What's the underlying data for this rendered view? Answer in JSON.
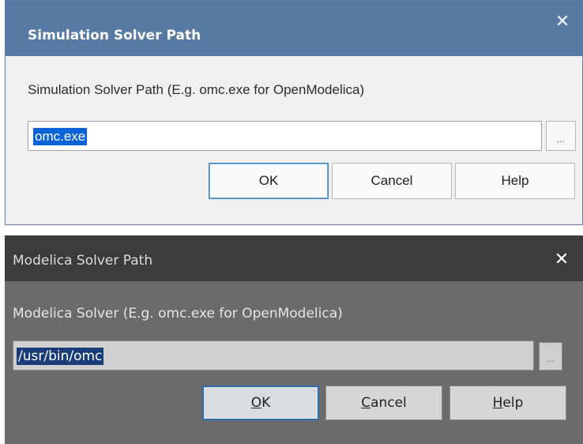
{
  "dialog_light": {
    "title": "Simulation Solver Path",
    "label": "Simulation Solver Path (E.g. omc.exe for OpenModelica)",
    "path_value": "omc.exe",
    "browse_label": "...",
    "ok_label": "OK",
    "cancel_label": "Cancel",
    "help_label": "Help",
    "close_glyph": "✕"
  },
  "dialog_dark": {
    "title": "Modelica Solver Path",
    "label": "Modelica Solver (E.g. omc.exe for OpenModelica)",
    "path_value": "/usr/bin/omc",
    "browse_label": "...",
    "ok_mnemonic": "O",
    "ok_rest": "K",
    "cancel_mnemonic": "C",
    "cancel_rest": "ancel",
    "help_mnemonic": "H",
    "help_rest": "elp",
    "close_glyph": "✕"
  },
  "colors": {
    "light_titlebar": "#567aa3",
    "dark_titlebar": "#3b3b3b",
    "selection_light": "#0a64d8",
    "selection_dark": "#1a3d7a"
  }
}
